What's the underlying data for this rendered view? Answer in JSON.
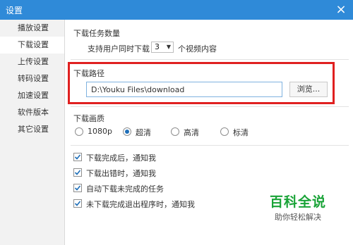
{
  "window": {
    "title": "设置",
    "close_glyph": "×"
  },
  "sidebar": {
    "items": [
      {
        "label": "播放设置",
        "active": false
      },
      {
        "label": "下载设置",
        "active": true
      },
      {
        "label": "上传设置",
        "active": false
      },
      {
        "label": "转码设置",
        "active": false
      },
      {
        "label": "加速设置",
        "active": false
      },
      {
        "label": "软件版本",
        "active": false
      },
      {
        "label": "其它设置",
        "active": false
      }
    ]
  },
  "download_tasks": {
    "title": "下载任务数量",
    "prefix": "支持用户同时下载",
    "count": "3",
    "suffix": "个视频内容"
  },
  "download_path": {
    "title": "下载路径",
    "value": "D:\\Youku Files\\download",
    "browse_label": "浏览..."
  },
  "quality": {
    "title": "下载画质",
    "options": [
      {
        "label": "1080p",
        "selected": false
      },
      {
        "label": "超清",
        "selected": true
      },
      {
        "label": "高清",
        "selected": false
      },
      {
        "label": "标清",
        "selected": false
      }
    ]
  },
  "notifications": [
    {
      "label": "下载完成后，通知我",
      "checked": true
    },
    {
      "label": "下载出错时，通知我",
      "checked": true
    },
    {
      "label": "自动下载未完成的任务",
      "checked": true
    },
    {
      "label": "未下载完成退出程序时，通知我",
      "checked": true
    }
  ],
  "watermark": {
    "brand": "百科全说",
    "tagline": "助你轻松解决"
  },
  "colors": {
    "titlebar": "#2f8ad8",
    "highlight_box": "#e02020",
    "watermark_green": "#19a337",
    "check_mark": "#1f6fb8"
  },
  "icons": {
    "dropdown": "chevron-down-icon",
    "close": "close-icon",
    "check": "check-icon"
  }
}
